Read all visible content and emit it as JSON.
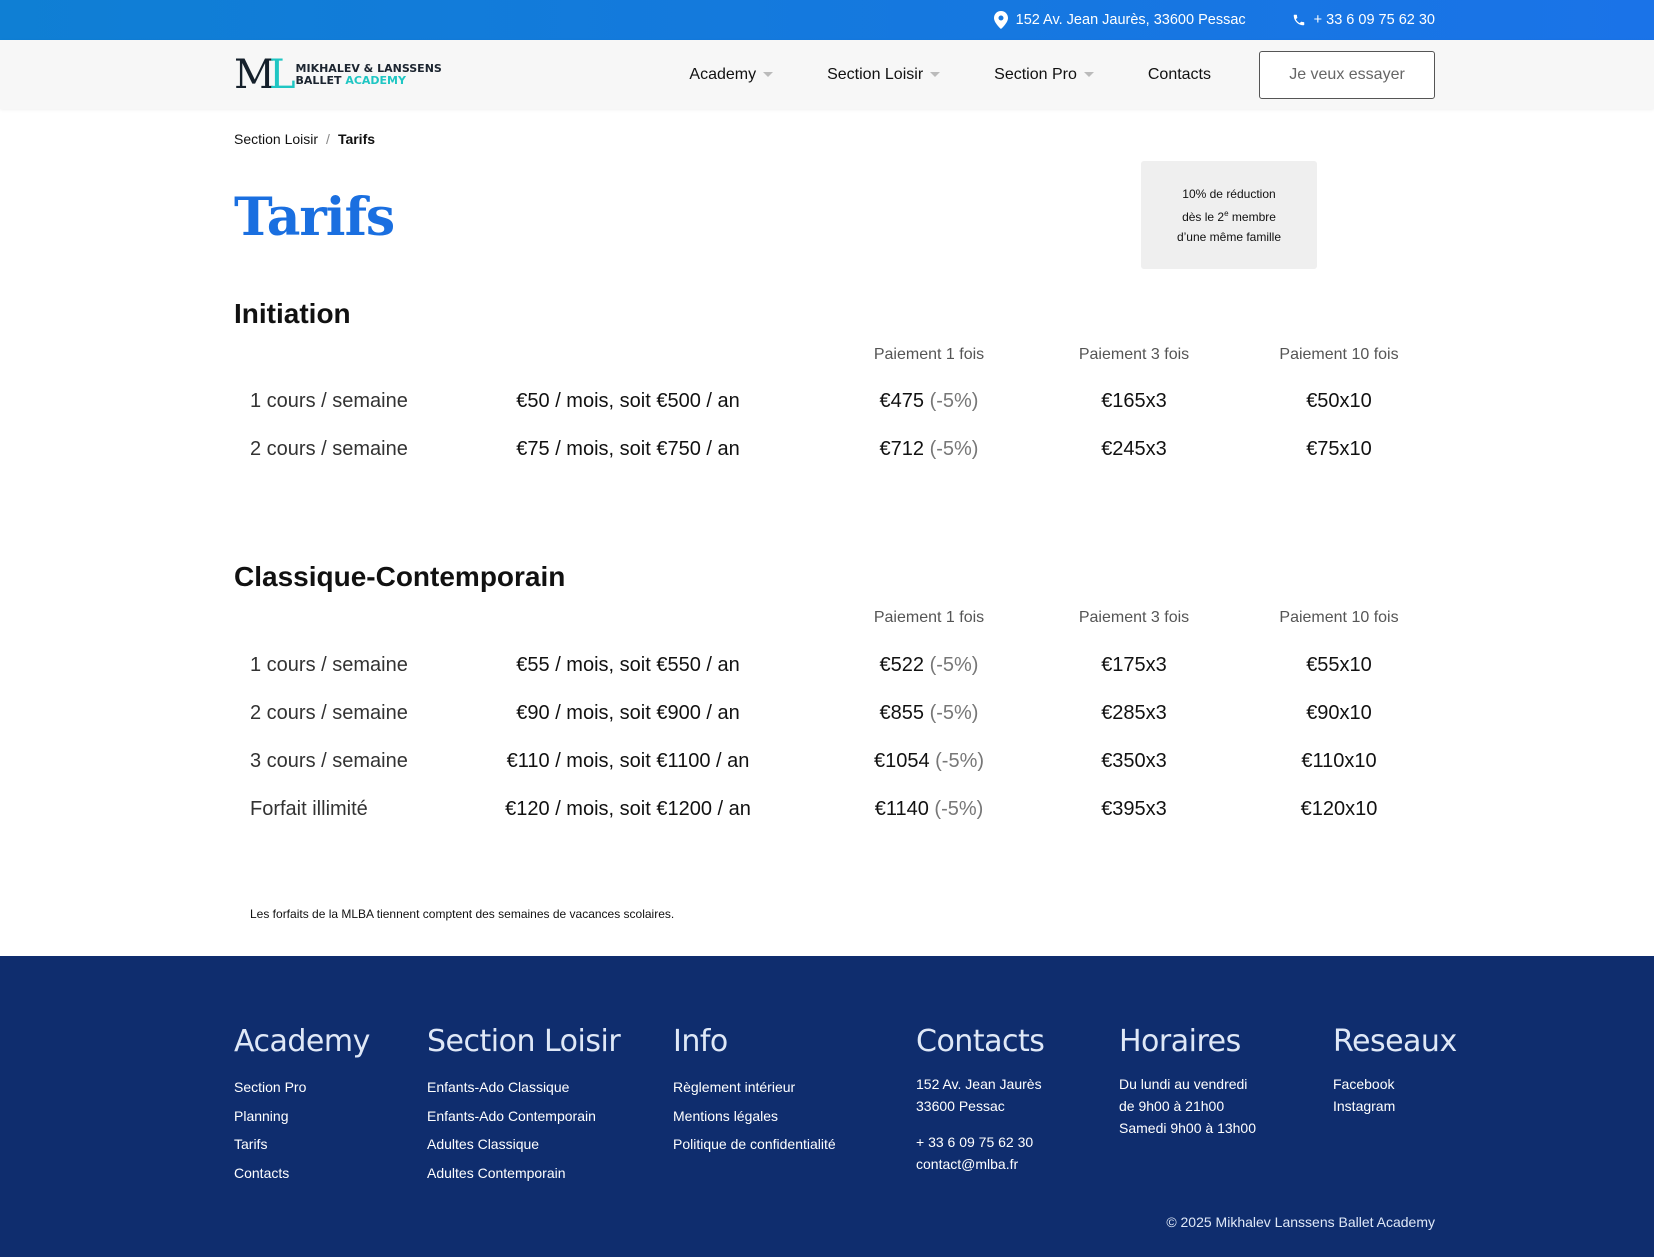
{
  "topbar": {
    "address": "152 Av. Jean Jaurès, 33600 Pessac",
    "phone": "+ 33 6 09 75 62 30",
    "icons": [
      "location-pin-icon",
      "phone-icon"
    ]
  },
  "header": {
    "logo": {
      "line1": "MIKHALEV & LANSSENS",
      "line2a": "BALLET",
      "line2b": "ACADEMY"
    },
    "nav": [
      {
        "label": "Academy",
        "dropdown": true
      },
      {
        "label": "Section Loisir",
        "dropdown": true
      },
      {
        "label": "Section Pro",
        "dropdown": true
      },
      {
        "label": "Contacts",
        "dropdown": false
      }
    ],
    "cta_label": "Je veux essayer"
  },
  "breadcrumb": {
    "parent": "Section Loisir",
    "separator": "/",
    "current": "Tarifs"
  },
  "page_title": "Tarifs",
  "promo": {
    "line1": "10% de réduction",
    "line2a": "dès le 2",
    "line2sup": "e",
    "line2b": " membre",
    "line3": "d’une même famille"
  },
  "column_headers": [
    "Paiement 1 fois",
    "Paiement 3 fois",
    "Paiement 10 fois"
  ],
  "sections": [
    {
      "title": "Initiation",
      "rows": [
        {
          "label": "1 cours / semaine",
          "price": "€50 / mois, soit €500 / an",
          "p1": "€475",
          "p1_disc": "(-5%)",
          "p3": "€165x3",
          "p10": "€50x10"
        },
        {
          "label": "2 cours / semaine",
          "price": "€75 / mois, soit €750 / an",
          "p1": "€712",
          "p1_disc": "(-5%)",
          "p3": "€245x3",
          "p10": "€75x10"
        }
      ]
    },
    {
      "title": "Classique-Contemporain",
      "rows": [
        {
          "label": "1 cours / semaine",
          "price": "€55 / mois, soit €550 / an",
          "p1": "€522",
          "p1_disc": "(-5%)",
          "p3": "€175x3",
          "p10": "€55x10"
        },
        {
          "label": "2 cours / semaine",
          "price": "€90 / mois, soit €900 / an",
          "p1": "€855",
          "p1_disc": "(-5%)",
          "p3": "€285x3",
          "p10": "€90x10"
        },
        {
          "label": "3 cours / semaine",
          "price": "€110 / mois, soit €1100 / an",
          "p1": "€1054",
          "p1_disc": "(-5%)",
          "p3": "€350x3",
          "p10": "€110x10"
        },
        {
          "label": "Forfait illimité",
          "price": "€120 / mois, soit €1200 / an",
          "p1": "€1140",
          "p1_disc": "(-5%)",
          "p3": "€395x3",
          "p10": "€120x10"
        }
      ]
    }
  ],
  "footnote": "Les forfaits de la MLBA tiennent comptent des semaines de vacances scolaires.",
  "footer": {
    "academy": {
      "title": "Academy",
      "links": [
        "Section Pro",
        "Planning",
        "Tarifs",
        "Contacts"
      ]
    },
    "loisir": {
      "title": "Section Loisir",
      "links": [
        "Enfants-Ado Classique",
        "Enfants-Ado Contemporain",
        "Adultes Classique",
        "Adultes Contemporain"
      ]
    },
    "info": {
      "title": "Info",
      "links": [
        "Règlement intérieur",
        "Mentions légales",
        "Politique de confidentialité"
      ]
    },
    "contacts": {
      "title": "Contacts",
      "address1": "152 Av. Jean Jaurès",
      "address2": "33600 Pessac",
      "phone": "+ 33 6 09 75 62 30",
      "email": "contact@mlba.fr"
    },
    "horaires": {
      "title": "Horaires",
      "line1": "Du lundi au vendredi",
      "line2": "de 9h00 à 21h00",
      "line3": "Samedi 9h00 à 13h00"
    },
    "reseaux": {
      "title": "Reseaux",
      "links": [
        "Facebook",
        "Instagram"
      ]
    },
    "copyright": "© 2025 Mikhalev Lanssens Ballet Academy"
  },
  "colors": {
    "accent_blue": "#1a6fe0",
    "footer_bg": "#0f2d6e",
    "logo_teal": "#1fc6c3"
  }
}
